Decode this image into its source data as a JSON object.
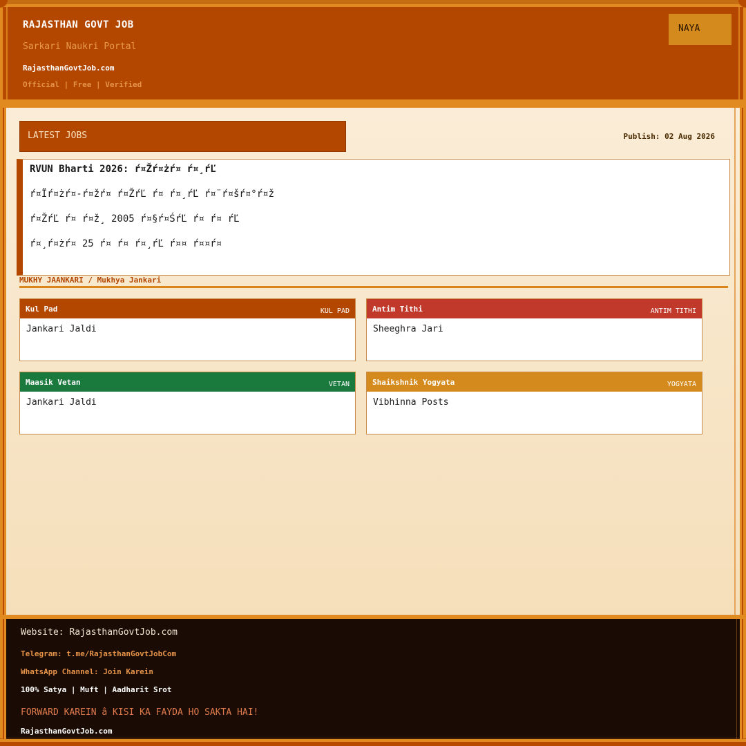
{
  "header": {
    "title": "RAJASTHAN GOVT JOB",
    "subtitle": "Sarkari Naukri Portal",
    "site": "RajasthanGovtJob.com",
    "tags": "Official | Free | Verified",
    "badge": "NAYA"
  },
  "main": {
    "section_title": "LATEST JOBS",
    "publish": "Publish: 02 Aug 2026",
    "notice_lines": [
      "RVUN Bharti 2026: ŕ¤Žŕ¤żŕ¤ ŕ¤¸ŕĽ",
      "ŕ¤Ïŕ¤żŕ¤-ŕ¤žŕ¤  ŕ¤ŽŕĽ ŕ¤  ŕ¤¸ŕĽ ŕ¤¨ŕ¤šŕ¤°ŕ¤ž",
      "ŕ¤ŽŕĽ ŕ¤ ŕ¤ž¸ 2005 ŕ¤§ŕ¤ŚŕĽ ŕ¤  ŕ¤ ŕĽ",
      "ŕ¤¸ŕ¤żŕ¤  25 ŕ¤ ŕ¤ ŕ¤¸ŕĽ ŕ¤¤ ŕ¤¤ŕ¤"
    ],
    "info_label": "MUKHY JAANKARI / Mukhya Jankari",
    "cards": [
      {
        "title": "Kul Pad",
        "tag": "KUL PAD",
        "value": "Jankari Jaldi",
        "color": "#b34700"
      },
      {
        "title": "Antim Tithi",
        "tag": "ANTIM TITHI",
        "value": "Sheeghra Jari",
        "color": "#c0392b"
      },
      {
        "title": "Maasik Vetan",
        "tag": "VETAN",
        "value": "Jankari Jaldi",
        "color": "#1a7a3e"
      },
      {
        "title": "Shaikshnik Yogyata",
        "tag": "YOGYATA",
        "value": "Vibhinna Posts",
        "color": "#d58a1d"
      }
    ]
  },
  "footer": {
    "website": "Website: RajasthanGovtJob.com",
    "telegram": "Telegram: t.me/RajasthanGovtJobCom",
    "whatsapp": "WhatsApp Channel: Join Karein",
    "truth": "100% Satya | Muft | Aadharit Srot",
    "forward": "FORWARD KAREIN â   KISI KA FAYDA HO SAKTA HAI!",
    "site": "RajasthanGovtJob.com"
  },
  "colors": {
    "primary": "#b34700",
    "accent": "#e08a1f",
    "background": "#faecd6",
    "footer_bg": "#1a0c04"
  }
}
